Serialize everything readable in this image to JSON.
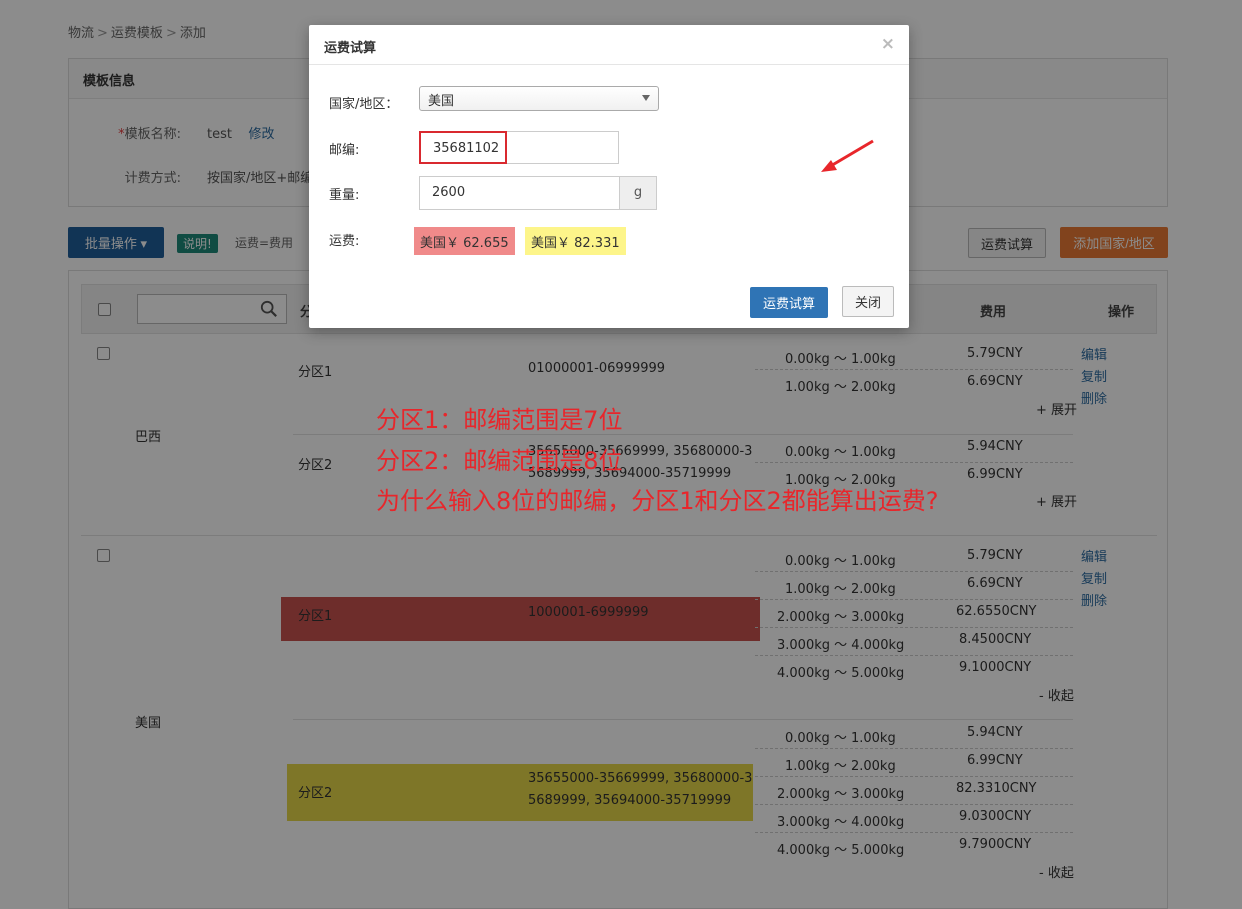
{
  "breadcrumb": [
    "物流",
    "运费模板",
    "添加"
  ],
  "template_info": {
    "title": "模板信息",
    "name_label": "模板名称:",
    "name_value": "test",
    "edit_link": "修改",
    "billing_label": "计费方式:",
    "billing_value": "按国家/地区+邮编"
  },
  "toolbar": {
    "batch_label": "批量操作",
    "note_badge": "说明!",
    "note_text": "运费=费用",
    "calc_label": "运费试算",
    "add_label": "添加国家/地区"
  },
  "table": {
    "col_zone": "分",
    "col_fee": "费用",
    "col_ops": "操作",
    "countries": [
      {
        "name": "巴西",
        "zones": [
          {
            "name": "分区1",
            "zip": "01000001-06999999",
            "rows": [
              [
                "0.00kg ～ 1.00kg",
                "5.79CNY"
              ],
              [
                "1.00kg ～ 2.00kg",
                "6.69CNY"
              ]
            ],
            "toggle": "+ 展开"
          },
          {
            "name": "分区2",
            "zip": "35655000-35669999, 35680000-35689999, 35694000-35719999",
            "rows": [
              [
                "0.00kg ～ 1.00kg",
                "5.94CNY"
              ],
              [
                "1.00kg ～ 2.00kg",
                "6.99CNY"
              ]
            ],
            "toggle": "+ 展开"
          }
        ],
        "ops": [
          "编辑",
          "复制",
          "删除"
        ]
      },
      {
        "name": "美国",
        "zones": [
          {
            "name": "分区1",
            "zip": "1000001-6999999",
            "rows": [
              [
                "0.00kg ～ 1.00kg",
                "5.79CNY"
              ],
              [
                "1.00kg ～ 2.00kg",
                "6.69CNY"
              ],
              [
                "2.000kg ～ 3.000kg",
                "62.6550CNY"
              ],
              [
                "3.000kg ～ 4.000kg",
                "8.4500CNY"
              ],
              [
                "4.000kg ～ 5.000kg",
                "9.1000CNY"
              ]
            ],
            "toggle": "- 收起"
          },
          {
            "name": "分区2",
            "zip": "35655000-35669999, 35680000-35689999, 35694000-35719999",
            "rows": [
              [
                "0.00kg ～ 1.00kg",
                "5.94CNY"
              ],
              [
                "1.00kg ～ 2.00kg",
                "6.99CNY"
              ],
              [
                "2.000kg ～ 3.000kg",
                "82.3310CNY"
              ],
              [
                "3.000kg ～ 4.000kg",
                "9.0300CNY"
              ],
              [
                "4.000kg ～ 5.000kg",
                "9.7900CNY"
              ]
            ],
            "toggle": "- 收起"
          }
        ],
        "ops": [
          "编辑",
          "复制",
          "删除"
        ]
      }
    ]
  },
  "annotation": [
    "分区1：邮编范围是7位",
    "分区2：邮编范围是8位",
    "为什么输入8位的邮编，分区1和分区2都能算出运费?"
  ],
  "modal": {
    "title": "运费试算",
    "close_glyph": "×",
    "country_label": "国家/地区：",
    "country_value": "美国",
    "zip_label": "邮编:",
    "zip_value": "35681102",
    "weight_label": "重量:",
    "weight_value": "2600",
    "weight_unit": "g",
    "fee_label": "运费:",
    "fee_results": [
      "美国￥ 62.655",
      "美国￥ 82.331"
    ],
    "calc_button": "运费试算",
    "close_button": "关闭"
  },
  "colors": {
    "primary": "#2f74b5",
    "orange": "#ec7b35",
    "fee_red": "#f08a8a",
    "fee_yellow": "#fdf58a",
    "annotation": "#e8262b"
  }
}
